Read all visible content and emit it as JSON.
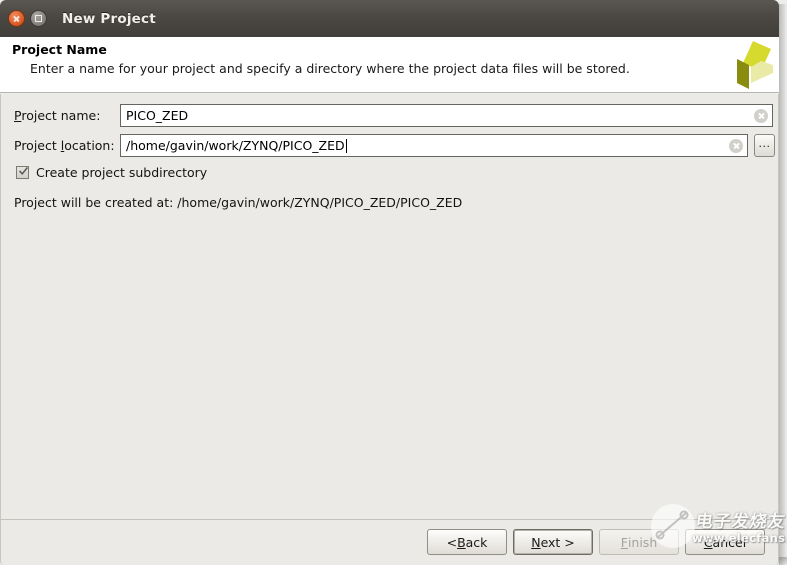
{
  "window": {
    "title": "New Project",
    "close_icon": "close-icon",
    "maximize_icon": "maximize-icon"
  },
  "header": {
    "title": "Project Name",
    "description": "Enter a name for your project and specify a directory where the project data files will be stored.",
    "logo_icon": "xilinx-logo",
    "logo_colors": {
      "bright_yellow": "#d6d92e",
      "dark_olive": "#8a8c10",
      "pale_yellow": "#e8eaa6"
    }
  },
  "form": {
    "project_name": {
      "label_pre": "P",
      "label_post": "roject name:",
      "value": "PICO_ZED",
      "placeholder": "",
      "clear_icon": "clear-icon"
    },
    "project_location": {
      "label_pre_a": "Project ",
      "label_mnemonic": "l",
      "label_post": "ocation:",
      "value": "/home/gavin/work/ZYNQ/PICO_ZED",
      "placeholder": "",
      "clear_icon": "clear-icon",
      "browse_label": "...",
      "has_caret": true
    },
    "create_subdirectory": {
      "label": "Create project subdirectory",
      "checked": true,
      "check_icon": "checkmark-icon"
    },
    "created_at_text": "Project will be created at: /home/gavin/work/ZYNQ/PICO_ZED/PICO_ZED"
  },
  "footer": {
    "buttons": [
      {
        "name": "back",
        "pre": "< ",
        "mnemonic": "B",
        "post": "ack",
        "state": "enabled"
      },
      {
        "name": "next",
        "pre": "",
        "mnemonic": "N",
        "post": "ext >",
        "state": "focused"
      },
      {
        "name": "finish",
        "pre": "",
        "mnemonic": "F",
        "post": "inish",
        "state": "disabled"
      },
      {
        "name": "cancel",
        "pre": "",
        "mnemonic": "C",
        "post": "ancel",
        "state": "enabled"
      }
    ]
  },
  "watermark": {
    "chinese": "电子发烧友",
    "url": "www.elecfans.com",
    "logo_icon": "elecfans-logo"
  },
  "colors": {
    "titlebar": "#4a4742",
    "close_button": "#e0622d",
    "body_bg": "#ebeae6",
    "header_bg": "#ffffff"
  }
}
